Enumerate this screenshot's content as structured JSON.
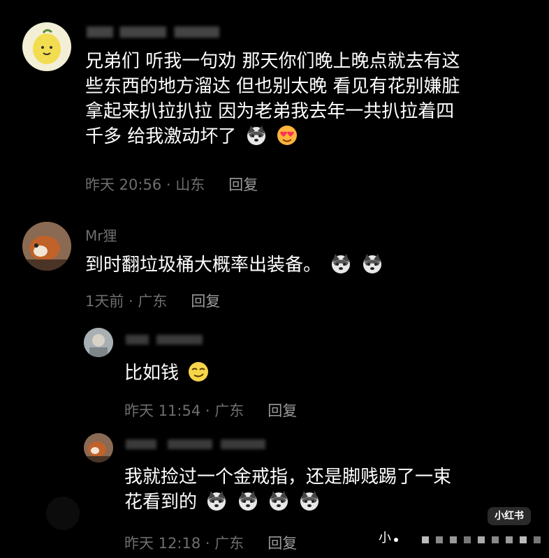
{
  "comments": [
    {
      "text": "兄弟们 听我一句劝 那天你们晚上晚点就去有这些东西的地方溜达 但也别太晚 看见有花别嫌脏拿起来扒拉扒拉 因为老弟我去年一共扒拉着四千多 给我激动坏了",
      "lines": [
        "兄弟们 听我一句劝 那天你们晚上晚点就去有这",
        "些东西的地方溜达 但也别太晚 看见有花别嫌脏",
        "拿起来扒拉扒拉 因为老弟我去年一共扒拉着四",
        "千多  给我激动坏了"
      ],
      "meta": "昨天 20:56 · 山东",
      "reply": "回复",
      "emojis": [
        "husky-emoji",
        "heart-eyes-emoji"
      ]
    },
    {
      "name": "Mr狸",
      "text": "到时翻垃圾桶大概率出装备。",
      "meta": "1天前 · 广东",
      "reply": "回复",
      "emojis": [
        "husky-emoji",
        "husky-emoji"
      ]
    },
    {
      "text": "比如钱",
      "meta": "昨天 11:54 · 广东",
      "reply": "回复",
      "emojis": [
        "smirk-emoji"
      ]
    },
    {
      "lines": [
        "我就捡过一个金戒指，还是脚贱踢了一束",
        "花看到的"
      ],
      "meta": "昨天 12:18 · 广东",
      "reply": "回复",
      "emojis": [
        "husky-emoji",
        "husky-emoji",
        "husky-emoji",
        "husky-emoji"
      ]
    }
  ],
  "watermark": "小红书",
  "bottom_label": "小",
  "colors": {
    "background": "#000000",
    "meta": "#6e6e6e",
    "text": "#ffffff"
  }
}
